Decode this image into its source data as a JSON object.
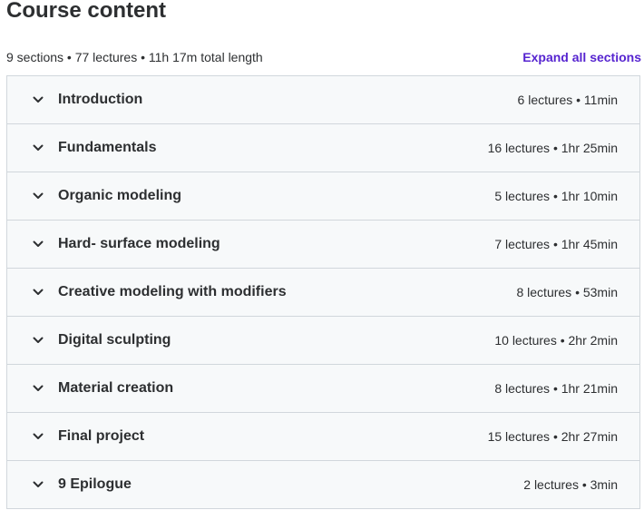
{
  "header": {
    "title": "Course content",
    "summary": "9 sections • 77 lectures • 11h 17m total length",
    "expand_label": "Expand all sections"
  },
  "colors": {
    "accent": "#5624d0",
    "row_background": "#f7f9fa",
    "border": "#d1d7dc",
    "text": "#2d2f31"
  },
  "sections": [
    {
      "title": "Introduction",
      "meta": "6 lectures • 11min",
      "icon": "chevron-down-icon"
    },
    {
      "title": "Fundamentals",
      "meta": "16 lectures • 1hr 25min",
      "icon": "chevron-down-icon"
    },
    {
      "title": "Organic modeling",
      "meta": "5 lectures • 1hr 10min",
      "icon": "chevron-down-icon"
    },
    {
      "title": "Hard- surface modeling",
      "meta": "7 lectures • 1hr 45min",
      "icon": "chevron-down-icon"
    },
    {
      "title": "Creative modeling with modifiers",
      "meta": "8 lectures • 53min",
      "icon": "chevron-down-icon"
    },
    {
      "title": "Digital sculpting",
      "meta": "10 lectures • 2hr 2min",
      "icon": "chevron-down-icon"
    },
    {
      "title": "Material creation",
      "meta": "8 lectures • 1hr 21min",
      "icon": "chevron-down-icon"
    },
    {
      "title": "Final project",
      "meta": "15 lectures • 2hr 27min",
      "icon": "chevron-down-icon"
    },
    {
      "title": "9 Epilogue",
      "meta": "2 lectures • 3min",
      "icon": "chevron-down-icon"
    }
  ]
}
